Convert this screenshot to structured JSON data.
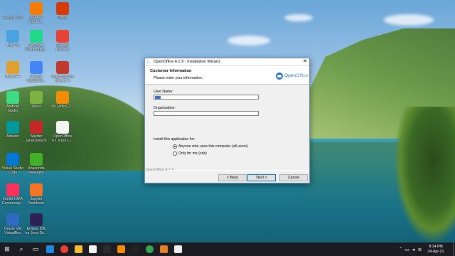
{
  "desktop": {
    "icons": [
      {
        "label": "Recycle Bin",
        "icon": "recycle-bin-icon",
        "color": "#6fa8dc"
      },
      {
        "label": "XAMPP\nContro...",
        "icon": "xampp-icon",
        "color": "#f57c00"
      },
      {
        "label": "Office",
        "icon": "office-icon",
        "color": "#d83b01"
      },
      {
        "label": "This PC",
        "icon": "this-pc-icon",
        "color": "#4aa3df"
      },
      {
        "label": "PyCharm\nCommunity...",
        "icon": "pycharm-icon",
        "color": "#21d789"
      },
      {
        "label": "Google\nChrome",
        "icon": "chrome-icon",
        "color": "#e94235"
      },
      {
        "label": "Dev-C++",
        "icon": "dev-cpp-icon",
        "color": "#e0a030"
      },
      {
        "label": "Google\nNotebook...",
        "icon": "google-icon",
        "color": "#4285f4"
      },
      {
        "label": "Embarcadero\nDev-C++",
        "icon": "embarcadero-icon",
        "color": "#c0392b"
      },
      {
        "label": "Android\nStudio",
        "icon": "android-studio-icon",
        "color": "#3ddc84"
      },
      {
        "label": "Vysor",
        "icon": "vysor-icon",
        "color": "#7cb342"
      },
      {
        "label": "vlc_video_2...",
        "icon": "vlc-icon",
        "color": "#f48b00"
      },
      {
        "label": "Arduino",
        "icon": "arduino-icon",
        "color": "#00979d"
      },
      {
        "label": "Spyder\n(anaconda3)",
        "icon": "spyder-icon",
        "color": "#c62828"
      },
      {
        "label": "OpenOffice\n4.1.9 (en-U...",
        "icon": "file-icon",
        "color": "#f5f5f5"
      },
      {
        "label": "Visual Studio\nCode",
        "icon": "vscode-icon",
        "color": "#0078d7"
      },
      {
        "label": "Anaconda\nNavigator",
        "icon": "anaconda-icon",
        "color": "#43b02a"
      },
      {
        "label": "IntelliJ IDEA\nCommunity...",
        "icon": "intellij-icon",
        "color": "#fe315d"
      },
      {
        "label": "Jupyter\nNotebook",
        "icon": "jupyter-icon",
        "color": "#f37626"
      },
      {
        "label": "Oracle VM\nVirtualBox",
        "icon": "virtualbox-icon",
        "color": "#2f6ac0"
      },
      {
        "label": "Eclipse IDE\nfor Java De...",
        "icon": "eclipse-icon",
        "color": "#2c2255"
      }
    ]
  },
  "dialog": {
    "title": "OpenOffice 4.1.9 - Installation Wizard",
    "close_glyph": "✕",
    "header_title": "Customer Information",
    "header_subtitle": "Please enter your information.",
    "logo_text_bold": "Open",
    "logo_text_thin": "Office",
    "user_name_label": "User Name:",
    "user_name_value": "",
    "organization_label": "Organization:",
    "organization_value": "",
    "install_for_label": "Install this application for:",
    "option_all_users": "Anyone who uses this computer (all users)",
    "option_only_me": "Only for me (sds)",
    "selected_option": "all_users",
    "brand_line": "OpenOffice 4.1.9",
    "back_button": "< Back",
    "next_button": "Next >",
    "cancel_button": "Cancel"
  },
  "taskbar": {
    "start_glyph": "⊞",
    "search_glyph": "⌕",
    "taskview_glyph": "▭",
    "apps": [
      {
        "icon": "edge-icon",
        "color": "#1e88e5"
      },
      {
        "icon": "chrome-icon",
        "color": "#e94235"
      },
      {
        "icon": "file-explorer-icon",
        "color": "#f3c033"
      },
      {
        "icon": "store-icon",
        "color": "#f5f5f5"
      },
      {
        "icon": "terminal-icon",
        "color": "#2b2b2b"
      },
      {
        "icon": "vlc-icon",
        "color": "#f48b00"
      },
      {
        "icon": "media-icon",
        "color": "#222222"
      },
      {
        "icon": "chrome-icon",
        "color": "#34a853"
      },
      {
        "icon": "installer-icon",
        "color": "#e67e22"
      },
      {
        "icon": "openoffice-icon",
        "color": "#eeeeee"
      }
    ],
    "clock_time": "8:14 PM",
    "clock_date": "24-Apr-21"
  }
}
